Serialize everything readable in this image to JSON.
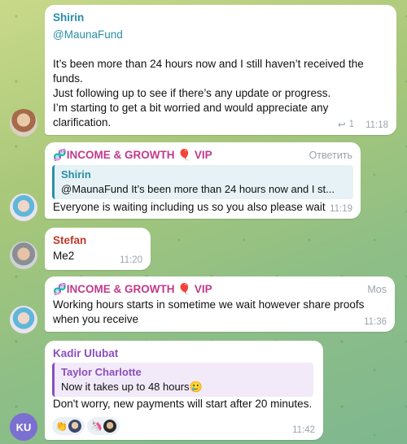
{
  "colors": {
    "shirin": "#2a8fa7",
    "income": "#c13a8c",
    "stefan": "#c0392b",
    "kadir": "#8a4fbf",
    "taylor": "#8a4fbf",
    "time": "#9aa4ad",
    "avatar_ku": "#7b6fd1"
  },
  "messages": [
    {
      "sender": "Shirin",
      "lines": [
        "@MaunaFund",
        "",
        "It’s been more than 24 hours now and I still haven’t received the",
        "funds.",
        "Just following up to see if there’s any update or progress.",
        "I’m starting to get a bit worried and would appreciate any",
        "clarification."
      ],
      "reply_count": "1",
      "time": "11:18"
    },
    {
      "sender": "🧬INCOME & GROWTH 🎈 VIP",
      "action": "Ответить",
      "reply_to": {
        "name": "Shirin",
        "text": "@MaunaFund   It’s been more than 24 hours now and I st..."
      },
      "text": "Everyone is waiting including us so you also please wait",
      "time": "11:19"
    },
    {
      "sender": "Stefan",
      "text": "Me2",
      "time": "11:20"
    },
    {
      "sender": "🧬INCOME & GROWTH 🎈 VIP",
      "role": "Mos",
      "lines": [
        "Working hours starts in sometime we wait however share proofs",
        "when you receive"
      ],
      "time": "11:36"
    },
    {
      "sender": "Kadir Ulubat",
      "avatar_initials": "KU",
      "reply_to": {
        "name": "Taylor Charlotte",
        "text": "Now it takes up to 48 hours🥲"
      },
      "text": "Don't worry, new payments will start after 20 minutes.",
      "reactions": [
        "👏",
        "🦄"
      ],
      "time": "11:42"
    }
  ]
}
